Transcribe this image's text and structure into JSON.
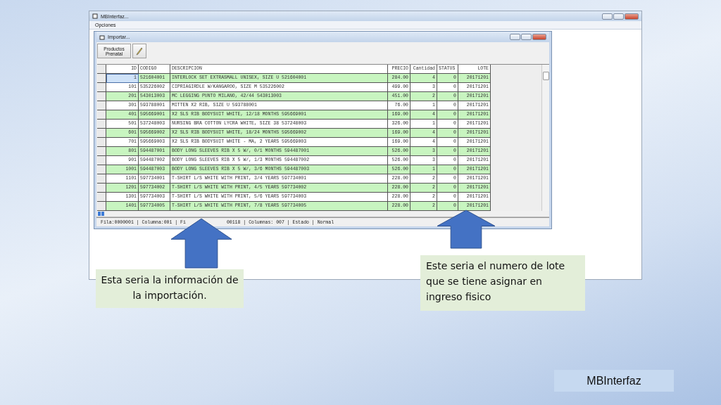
{
  "outer_window": {
    "title": "MBInterfaz...",
    "menu": [
      "Opciones"
    ]
  },
  "import_window": {
    "title": "Importar...",
    "toolbar_button": "Productos Prenatal",
    "table": {
      "columns": [
        "ID",
        "CODIGO",
        "DESCRIPCION",
        "PRECIO",
        "Cantidad",
        "STATUS",
        "LOTE"
      ],
      "rows": [
        {
          "selected": true,
          "cells": [
            "1",
            "521604001",
            "INTERLOCK SET EXTRASMALL UNISEX, SIZE U 521604001",
            "284.00",
            "4",
            "0",
            "20171201"
          ]
        },
        {
          "selected": false,
          "cells": [
            "101",
            "535226002",
            "CIPRIAGIRDLE W/KANGAROO, SIZE M 535226002",
            "499.00",
            "3",
            "0",
            "20171201"
          ]
        },
        {
          "selected": false,
          "cells": [
            "201",
            "543013003",
            "MC LEGGING PUNTO MILANO, 42/44 543013003",
            "451.00",
            "2",
            "0",
            "20171201"
          ]
        },
        {
          "selected": false,
          "cells": [
            "301",
            "593788001",
            "MITTEN X2 RIB, SIZE U 593788001",
            "76.00",
            "1",
            "0",
            "20171201"
          ]
        },
        {
          "selected": false,
          "cells": [
            "401",
            "595669001",
            "X2 SLS RIB BODYSUIT WHITE, 12/18 MONTHS 595669001",
            "169.00",
            "4",
            "0",
            "20171201"
          ]
        },
        {
          "selected": false,
          "cells": [
            "501",
            "537248003",
            "NURSING BRA COTTON LYCRA WHITE, SIZE 38 537248003",
            "326.00",
            "1",
            "0",
            "20171201"
          ]
        },
        {
          "selected": false,
          "cells": [
            "601",
            "595669002",
            "X2 SLS RIB BODYSUIT WHITE, 18/24 MONTHS 595669002",
            "169.00",
            "4",
            "0",
            "20171201"
          ]
        },
        {
          "selected": false,
          "cells": [
            "701",
            "595669003",
            "X2 SLS RIB BODYSUIT WHITE - MA, 2 YEARS 595669003",
            "169.00",
            "4",
            "0",
            "20171201"
          ]
        },
        {
          "selected": false,
          "cells": [
            "801",
            "594487001",
            "BODY LONG SLEEVES RIB X 5 W/, 0/1 MONTHS 594487001",
            "526.00",
            "3",
            "0",
            "20171201"
          ]
        },
        {
          "selected": false,
          "cells": [
            "901",
            "594487002",
            "BODY LONG SLEEVES RIB X 5 W/, 1/3 MONTHS 594487002",
            "526.00",
            "3",
            "0",
            "20171201"
          ]
        },
        {
          "selected": false,
          "cells": [
            "1001",
            "594487003",
            "BODY LONG SLEEVES RIB X 5 W/, 3/6 MONTHS 594487003",
            "526.00",
            "1",
            "0",
            "20171201"
          ]
        },
        {
          "selected": false,
          "cells": [
            "1101",
            "597734001",
            "T-SHIRT L/S WHITE WITH PRINT, 3/4 YEARS 597734001",
            "228.00",
            "2",
            "0",
            "20171201"
          ]
        },
        {
          "selected": false,
          "cells": [
            "1201",
            "597734002",
            "T-SHIRT L/S WHITE WITH PRINT, 4/5 YEARS 597734002",
            "228.00",
            "2",
            "0",
            "20171201"
          ]
        },
        {
          "selected": false,
          "cells": [
            "1301",
            "597734003",
            "T-SHIRT L/S WHITE WITH PRINT, 5/6 YEARS 597734003",
            "228.00",
            "2",
            "0",
            "20171201"
          ]
        },
        {
          "selected": false,
          "cells": [
            "1401",
            "597734005",
            "T-SHIRT L/S WHITE WITH PRINT, 7/8 YEARS 597734005",
            "228.00",
            "2",
            "0",
            "20171201"
          ]
        }
      ]
    },
    "status_bar": [
      "Fila:0000001 | Columna:001 | Fi",
      "00118 | Columnas: 007 | Estado | Normal"
    ]
  },
  "callouts": [
    "Esta seria la información de la importación.",
    "Este seria el numero de lote que se tiene asignar en ingreso fisico"
  ],
  "footer_label": "MBInterfaz"
}
